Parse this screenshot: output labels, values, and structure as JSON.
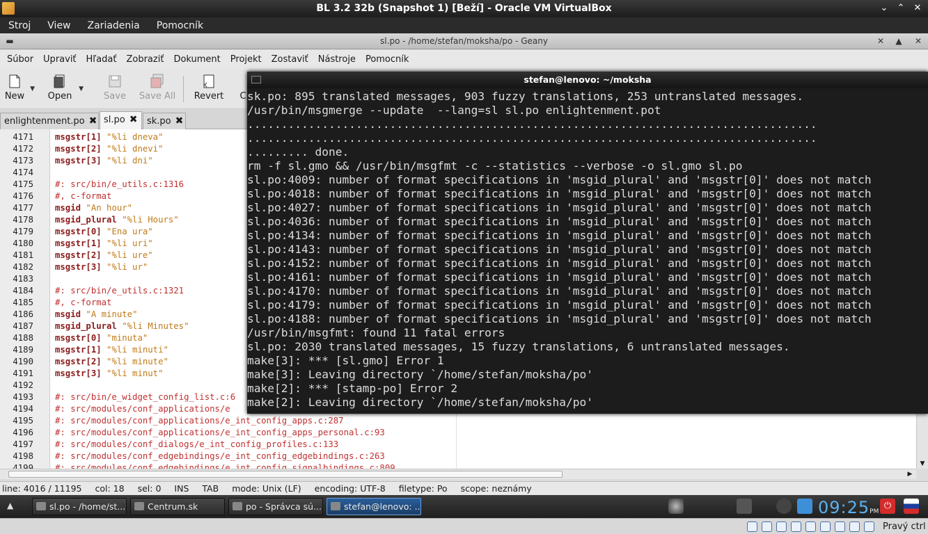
{
  "vbox": {
    "title": "BL 3.2 32b (Snapshot 1) [Beží] - Oracle VM VirtualBox",
    "menu": [
      "Stroj",
      "View",
      "Zariadenia",
      "Pomocník"
    ],
    "host_key": "Pravý ctrl"
  },
  "geany": {
    "title": "sl.po - /home/stefan/moksha/po - Geany",
    "menu": [
      "Súbor",
      "Upraviť",
      "Hľadať",
      "Zobraziť",
      "Dokument",
      "Projekt",
      "Zostaviť",
      "Nástroje",
      "Pomocník"
    ],
    "toolbar": {
      "new": "New",
      "open": "Open",
      "save": "Save",
      "save_all": "Save All",
      "revert": "Revert",
      "close_partial": "C"
    },
    "tabs": [
      "enlightenment.po",
      "sl.po",
      "sk.po"
    ],
    "status": {
      "line": "line: 4016 / 11195",
      "col": "col: 18",
      "sel": "sel: 0",
      "ins": "INS",
      "tab": "TAB",
      "mode": "mode: Unix (LF)",
      "encoding": "encoding: UTF-8",
      "filetype": "filetype: Po",
      "scope": "scope: neznámy"
    }
  },
  "editor_lines": [
    {
      "num": "4171",
      "kw": "msgstr[1]",
      "str": " \"%li dneva\"",
      "cmt": ""
    },
    {
      "num": "4172",
      "kw": "msgstr[2]",
      "str": " \"%li dnevi\"",
      "cmt": ""
    },
    {
      "num": "4173",
      "kw": "msgstr[3]",
      "str": " \"%li dni\"",
      "cmt": ""
    },
    {
      "num": "4174",
      "kw": "",
      "str": "",
      "cmt": ""
    },
    {
      "num": "4175",
      "kw": "",
      "str": "",
      "cmt": "#: src/bin/e_utils.c:1316"
    },
    {
      "num": "4176",
      "kw": "",
      "str": "",
      "cmt": "#, c-format"
    },
    {
      "num": "4177",
      "kw": "msgid",
      "str": " \"An hour\"",
      "cmt": ""
    },
    {
      "num": "4178",
      "kw": "msgid_plural",
      "str": " \"%li Hours\"",
      "cmt": ""
    },
    {
      "num": "4179",
      "kw": "msgstr[0]",
      "str": " \"Ena ura\"",
      "cmt": ""
    },
    {
      "num": "4180",
      "kw": "msgstr[1]",
      "str": " \"%li uri\"",
      "cmt": ""
    },
    {
      "num": "4181",
      "kw": "msgstr[2]",
      "str": " \"%li ure\"",
      "cmt": ""
    },
    {
      "num": "4182",
      "kw": "msgstr[3]",
      "str": " \"%li ur\"",
      "cmt": ""
    },
    {
      "num": "4183",
      "kw": "",
      "str": "",
      "cmt": ""
    },
    {
      "num": "4184",
      "kw": "",
      "str": "",
      "cmt": "#: src/bin/e_utils.c:1321"
    },
    {
      "num": "4185",
      "kw": "",
      "str": "",
      "cmt": "#, c-format"
    },
    {
      "num": "4186",
      "kw": "msgid",
      "str": " \"A minute\"",
      "cmt": ""
    },
    {
      "num": "4187",
      "kw": "msgid_plural",
      "str": " \"%li Minutes\"",
      "cmt": ""
    },
    {
      "num": "4188",
      "kw": "msgstr[0]",
      "str": " \"minuta\"",
      "cmt": ""
    },
    {
      "num": "4189",
      "kw": "msgstr[1]",
      "str": " \"%li minuti\"",
      "cmt": ""
    },
    {
      "num": "4190",
      "kw": "msgstr[2]",
      "str": " \"%li minute\"",
      "cmt": ""
    },
    {
      "num": "4191",
      "kw": "msgstr[3]",
      "str": " \"%li minut\"",
      "cmt": ""
    },
    {
      "num": "4192",
      "kw": "",
      "str": "",
      "cmt": ""
    },
    {
      "num": "4193",
      "kw": "",
      "str": "",
      "cmt": "#: src/bin/e_widget_config_list.c:6"
    },
    {
      "num": "4194",
      "kw": "",
      "str": "",
      "cmt": "#: src/modules/conf_applications/e"
    },
    {
      "num": "4195",
      "kw": "",
      "str": "",
      "cmt": "#: src/modules/conf_applications/e_int_config_apps.c:287"
    },
    {
      "num": "4196",
      "kw": "",
      "str": "",
      "cmt": "#: src/modules/conf_applications/e_int_config_apps_personal.c:93"
    },
    {
      "num": "4197",
      "kw": "",
      "str": "",
      "cmt": "#: src/modules/conf_dialogs/e_int_config_profiles.c:133"
    },
    {
      "num": "4198",
      "kw": "",
      "str": "",
      "cmt": "#: src/modules/conf_edgebindings/e_int_config_edgebindings.c:263"
    },
    {
      "num": "4199",
      "kw": "",
      "str": "",
      "cmt": "#: src/modules/conf_edgebindings/e_int_config_signalbindings.c:809"
    }
  ],
  "terminal": {
    "title": "stefan@lenovo: ~/moksha",
    "lines": [
      "sk.po: 895 translated messages, 903 fuzzy translations, 253 untranslated messages.",
      "/usr/bin/msgmerge --update  --lang=sl sl.po enlightenment.pot",
      "....................................................................................",
      "....................................................................................",
      "......... done.",
      "rm -f sl.gmo && /usr/bin/msgfmt -c --statistics --verbose -o sl.gmo sl.po",
      "sl.po:4009: number of format specifications in 'msgid_plural' and 'msgstr[0]' does not match",
      "sl.po:4018: number of format specifications in 'msgid_plural' and 'msgstr[0]' does not match",
      "sl.po:4027: number of format specifications in 'msgid_plural' and 'msgstr[0]' does not match",
      "sl.po:4036: number of format specifications in 'msgid_plural' and 'msgstr[0]' does not match",
      "sl.po:4134: number of format specifications in 'msgid_plural' and 'msgstr[0]' does not match",
      "sl.po:4143: number of format specifications in 'msgid_plural' and 'msgstr[0]' does not match",
      "sl.po:4152: number of format specifications in 'msgid_plural' and 'msgstr[0]' does not match",
      "sl.po:4161: number of format specifications in 'msgid_plural' and 'msgstr[0]' does not match",
      "sl.po:4170: number of format specifications in 'msgid_plural' and 'msgstr[0]' does not match",
      "sl.po:4179: number of format specifications in 'msgid_plural' and 'msgstr[0]' does not match",
      "sl.po:4188: number of format specifications in 'msgid_plural' and 'msgstr[0]' does not match",
      "/usr/bin/msgfmt: found 11 fatal errors",
      "sl.po: 2030 translated messages, 15 fuzzy translations, 6 untranslated messages.",
      "make[3]: *** [sl.gmo] Error 1",
      "make[3]: Leaving directory `/home/stefan/moksha/po'",
      "make[2]: *** [stamp-po] Error 2",
      "make[2]: Leaving directory `/home/stefan/moksha/po'"
    ]
  },
  "taskbar": {
    "tasks": [
      "sl.po - /home/st...",
      "Centrum.sk",
      "po - Správca sú...",
      "stefan@lenovo: ..."
    ],
    "clock": "09:25",
    "clock_suffix": "PM"
  },
  "colors": {
    "keyword": "#8b1a1a",
    "string": "#c07a1a",
    "comment": "#c03030",
    "terminal_bg": "#1c1c1c",
    "clock": "#5ab1f0"
  }
}
